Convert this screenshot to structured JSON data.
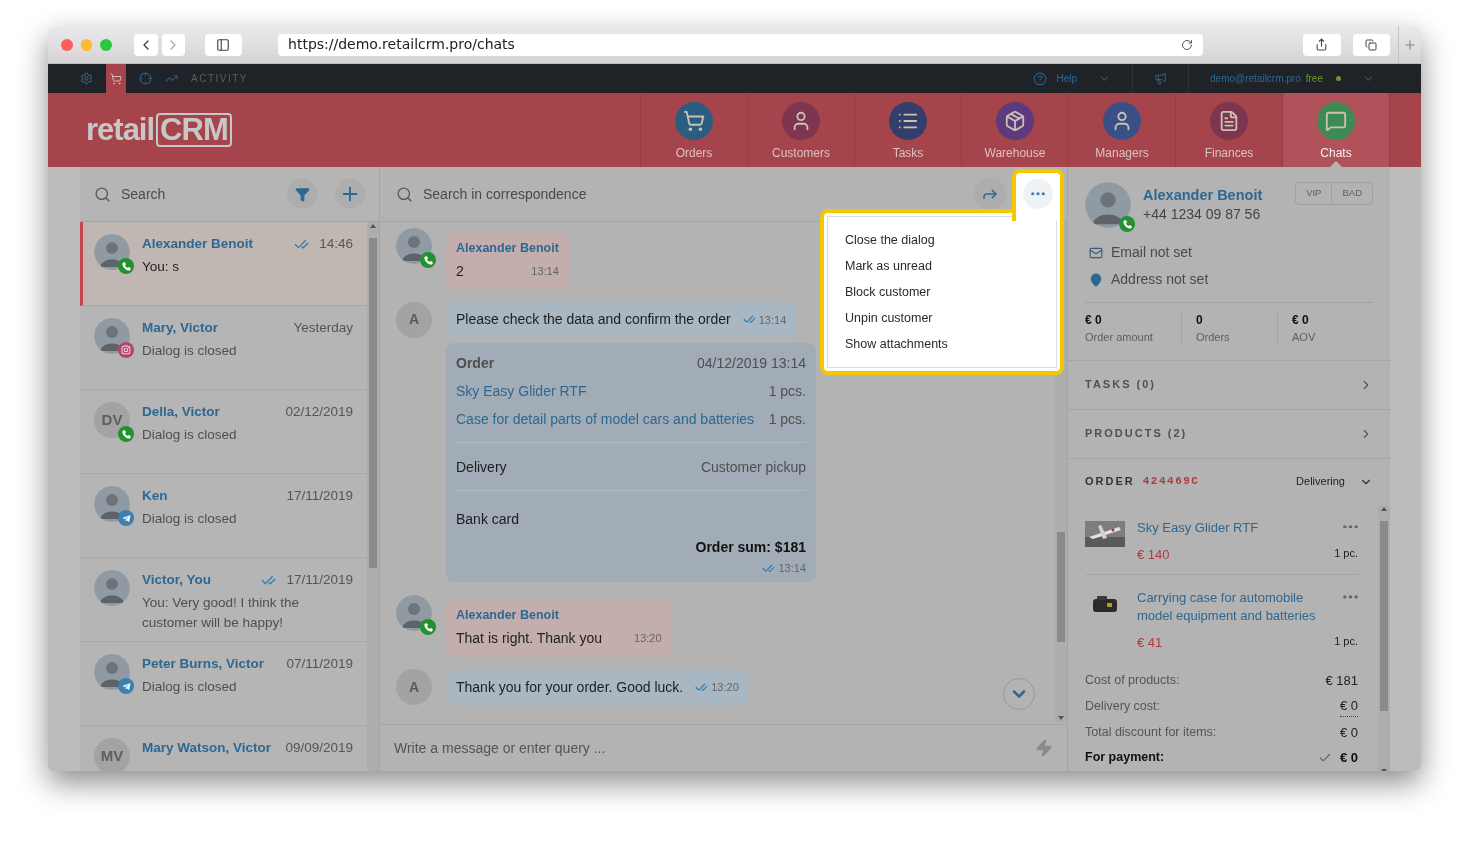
{
  "browser": {
    "url": "https://demo.retailcrm.pro/chats"
  },
  "top_bar": {
    "activity": "ACTIVITY",
    "help": "Help",
    "account": "demo@retailcrm.pro",
    "plan": "free"
  },
  "logo": {
    "text": "retail",
    "mark": "CRM"
  },
  "nav": [
    {
      "label": "Orders",
      "selected": false
    },
    {
      "label": "Customers",
      "selected": false
    },
    {
      "label": "Tasks",
      "selected": false
    },
    {
      "label": "Warehouse",
      "selected": false
    },
    {
      "label": "Managers",
      "selected": false
    },
    {
      "label": "Finances",
      "selected": false
    },
    {
      "label": "Chats",
      "selected": true
    }
  ],
  "chat_list": {
    "search_placeholder": "Search",
    "chats": [
      {
        "name": "Alexander Benoit",
        "preview": "You: s",
        "time": "14:46",
        "read": true,
        "selected": true,
        "kind": "phone"
      },
      {
        "name": "Mary, Victor",
        "preview": "Dialog is closed",
        "time": "Yesterday",
        "selected": false,
        "kind": "instagram"
      },
      {
        "name": "Della, Victor",
        "preview": "Dialog is closed",
        "time": "02/12/2019",
        "selected": false,
        "initials": "DV",
        "kind": "phone"
      },
      {
        "name": "Ken",
        "preview": "Dialog is closed",
        "time": "17/11/2019",
        "selected": false,
        "kind": "telegram"
      },
      {
        "name": "Victor, You",
        "preview": "You: Very good! I think the customer will be happy!",
        "time": "17/11/2019",
        "read": true,
        "selected": false
      },
      {
        "name": "Peter Burns, Victor",
        "preview": "Dialog is closed",
        "time": "07/11/2019",
        "selected": false,
        "kind": "telegram"
      },
      {
        "name": "Mary Watson, Victor",
        "time": "09/09/2019",
        "selected": false,
        "initials": "MV"
      }
    ]
  },
  "conversation": {
    "search_placeholder": "Search in correspondence",
    "composer_placeholder": "Write a message or enter query ...",
    "messages": [
      {
        "kind": "incoming",
        "author": "Alexander Benoit",
        "text": "2",
        "time": "13:14"
      },
      {
        "kind": "outgoing",
        "avatar": "A",
        "text": "Please check the data and confirm the order",
        "time": "13:14",
        "read": true
      },
      {
        "kind": "order",
        "title": "Order",
        "date": "04/12/2019 13:14",
        "items": [
          {
            "name": "Sky Easy Glider RTF",
            "qty": "1 pcs."
          },
          {
            "name": "Case for detail parts of model cars and batteries",
            "qty": "1 pcs."
          }
        ],
        "delivery_label": "Delivery",
        "delivery_value": "Customer pickup",
        "payment": "Bank card",
        "total": "Order sum: $181",
        "time": "13:14",
        "read": true
      },
      {
        "kind": "incoming",
        "author": "Alexander Benoit",
        "text": "That is right. Thank you",
        "time": "13:20"
      },
      {
        "kind": "outgoing",
        "avatar": "A",
        "text": "Thank you for your order. Good luck.",
        "time": "13:20",
        "read": true
      }
    ]
  },
  "menu": {
    "items": [
      "Close the dialog",
      "Mark as unread",
      "Block customer",
      "Unpin customer",
      "Show attachments"
    ]
  },
  "customer": {
    "name": "Alexander Benoit",
    "phone": "+44 1234 09 87 56",
    "email": "Email not set",
    "address": "Address not set",
    "tags": [
      "VIP",
      "BAD"
    ],
    "stats": [
      {
        "value": "€ 0",
        "label": "Order amount"
      },
      {
        "value": "0",
        "label": "Orders"
      },
      {
        "value": "€ 0",
        "label": "AOV"
      }
    ]
  },
  "sections": [
    "TASKS (0)",
    "PRODUCTS (2)"
  ],
  "order": {
    "label": "ORDER",
    "number": "424469C",
    "status": "Delivering",
    "items": [
      {
        "name": "Sky Easy Glider RTF",
        "price": "€ 140",
        "qty": "1 pc.",
        "kind": "plane"
      },
      {
        "name": "Carrying case for automobile model equipment and batteries",
        "price": "€ 41",
        "qty": "1 pc.",
        "kind": "case"
      }
    ],
    "totals": [
      {
        "label": "Cost of products:",
        "value": "€ 181",
        "kind": "plain"
      },
      {
        "label": "Delivery cost:",
        "value": "€ 0",
        "kind": "editable"
      },
      {
        "label": "Total discount for items:",
        "value": "€ 0",
        "kind": "plain"
      },
      {
        "label": "For payment:",
        "value": "€ 0",
        "kind": "total"
      }
    ]
  }
}
